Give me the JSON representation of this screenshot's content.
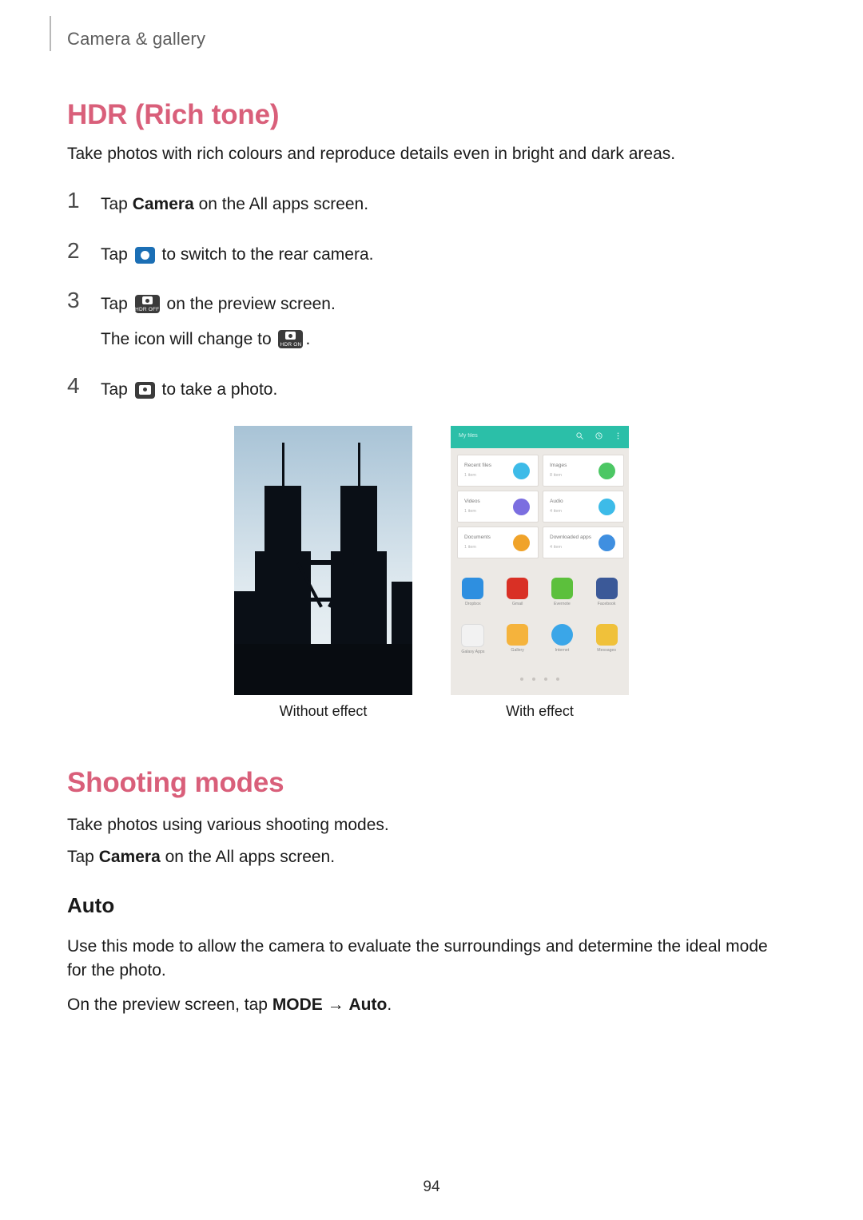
{
  "header": {
    "breadcrumb": "Camera & gallery"
  },
  "sections": {
    "hdr": {
      "title": "HDR (Rich tone)",
      "intro": "Take photos with rich colours and reproduce details even in bright and dark areas.",
      "steps": [
        {
          "num": "1",
          "pre": "Tap ",
          "bold": "Camera",
          "post": " on the All apps screen."
        },
        {
          "num": "2",
          "pre": "Tap ",
          "post": " to switch to the rear camera."
        },
        {
          "num": "3",
          "pre": "Tap ",
          "post": " on the preview screen."
        },
        {
          "num": "",
          "pre": "The icon will change to ",
          "post": "."
        },
        {
          "num": "4",
          "pre": "Tap ",
          "post": " to take a photo."
        }
      ],
      "captions": {
        "left": "Without effect",
        "right": "With effect"
      }
    },
    "shooting": {
      "title": "Shooting modes",
      "line1": "Take photos using various shooting modes.",
      "line2_pre": "Tap ",
      "line2_bold": "Camera",
      "line2_post": " on the All apps screen."
    },
    "auto": {
      "title": "Auto",
      "desc": "Use this mode to allow the camera to evaluate the surroundings and determine the ideal mode for the photo.",
      "action_pre": "On the preview screen, tap ",
      "action_bold1": "MODE",
      "action_arrow": " → ",
      "action_bold2": "Auto",
      "action_post": "."
    }
  },
  "icons": {
    "switch_camera": "switch-camera-icon",
    "hdr_off": "hdr-off-icon",
    "hdr_off_label": "HDR OFF",
    "hdr_on": "hdr-on-icon",
    "hdr_on_label": "HDR ON",
    "shutter": "shutter-icon"
  },
  "figure_right": {
    "app_bar_title": "My files",
    "cards": [
      {
        "title": "Recent files",
        "sub": "1 item",
        "color": "#3dbbe8"
      },
      {
        "title": "Images",
        "sub": "8 item",
        "color": "#4cc764"
      },
      {
        "title": "Videos",
        "sub": "1 item",
        "color": "#7b6ee0"
      },
      {
        "title": "Audio",
        "sub": "4 item",
        "color": "#3dbbe8"
      },
      {
        "title": "Documents",
        "sub": "1 item",
        "color": "#f0a32a"
      },
      {
        "title": "Downloaded apps",
        "sub": "4 item",
        "color": "#3f8fe0"
      }
    ],
    "apps_row1": [
      {
        "name": "Dropbox",
        "color": "#2e8fe0"
      },
      {
        "name": "Gmail",
        "color": "#d93025"
      },
      {
        "name": "Evernote",
        "color": "#5cc03c"
      },
      {
        "name": "Facebook",
        "color": "#3b5998"
      }
    ],
    "apps_row2": [
      {
        "name": "Galaxy Apps",
        "color": "#f2f2f2"
      },
      {
        "name": "Gallery",
        "color": "#f5b33c"
      },
      {
        "name": "Internet",
        "color": "#3aa6e8"
      },
      {
        "name": "Messages",
        "color": "#f0c13a"
      }
    ]
  },
  "footer": {
    "page_number": "94"
  },
  "colors": {
    "heading": "#d95f7a",
    "breadcrumb": "#5d5d5d",
    "accent_bar": "#2bbfa8"
  }
}
